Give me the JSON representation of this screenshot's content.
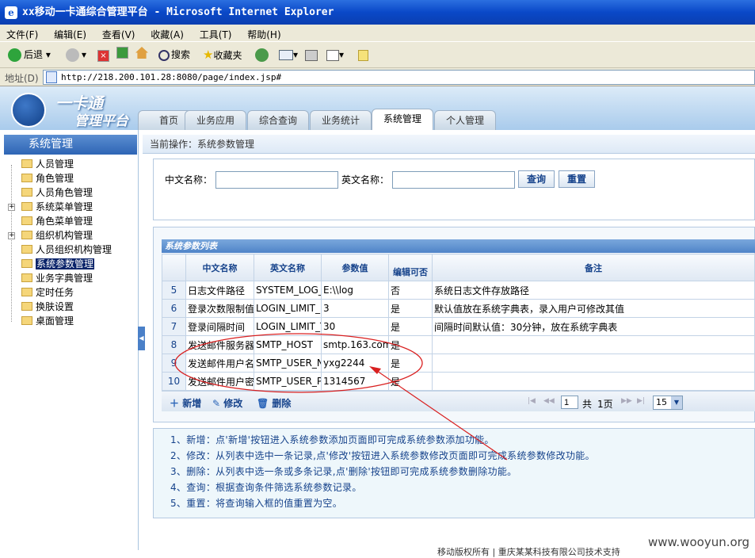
{
  "window": {
    "title": "xx移动一卡通综合管理平台 - Microsoft Internet Explorer"
  },
  "menu": [
    "文件(F)",
    "编辑(E)",
    "查看(V)",
    "收藏(A)",
    "工具(T)",
    "帮助(H)"
  ],
  "toolbar": {
    "back": "后退",
    "search": "搜索",
    "favorites": "收藏夹"
  },
  "address": {
    "label": "地址(D)",
    "url": "http://218.200.101.28:8080/page/index.jsp#"
  },
  "app": {
    "logo_line1": "一卡通",
    "logo_line2": "管理平台"
  },
  "tabs": [
    "首页",
    "业务应用",
    "综合查询",
    "业务统计",
    "系统管理",
    "个人管理"
  ],
  "sidebar": {
    "title": "系统管理",
    "items": [
      "人员管理",
      "角色管理",
      "人员角色管理",
      "系统菜单管理",
      "角色菜单管理",
      "组织机构管理",
      "人员组织机构管理",
      "系统参数管理",
      "业务字典管理",
      "定时任务",
      "换肤设置",
      "桌面管理"
    ]
  },
  "breadcrumb": "当前操作：系统参数管理",
  "search": {
    "cn_label": "中文名称：",
    "en_label": "英文名称：",
    "query": "查询",
    "reset": "重置",
    "cn_value": "",
    "en_value": ""
  },
  "grid": {
    "title": "系统参数列表",
    "columns": [
      "",
      "中文名称",
      "英文名称",
      "参数值",
      "编辑可否",
      "备注"
    ],
    "rows": [
      [
        "5",
        "日志文件路径",
        "SYSTEM_LOG_PATH",
        "E:\\\\log",
        "否",
        "系统日志文件存放路径"
      ],
      [
        "6",
        "登录次数限制值",
        "LOGIN_LIMIT_NUM",
        "3",
        "是",
        "默认值放在系统字典表，录入用户可修改其值"
      ],
      [
        "7",
        "登录间隔时间",
        "LOGIN_LIMIT_TIME",
        "30",
        "是",
        "间隔时间默认值：30分钟，放在系统字典表"
      ],
      [
        "8",
        "发送邮件服务器",
        "SMTP_HOST",
        "smtp.163.com",
        "是",
        ""
      ],
      [
        "9",
        "发送邮件用户名",
        "SMTP_USER_NAME",
        "yxg2244",
        "是",
        ""
      ],
      [
        "10",
        "发送邮件用户密码",
        "SMTP_USER_PASSWORD",
        "1314567",
        "是",
        ""
      ]
    ]
  },
  "pager": {
    "add": "新增",
    "edit": "修改",
    "delete": "删除",
    "page": "1",
    "total_prefix": "共",
    "total": "1页",
    "size": "15"
  },
  "help": [
    "1、新增：点'新增'按钮进入系统参数添加页面即可完成系统参数添加功能。",
    "2、修改：从列表中选中一条记录,点'修改'按钮进入系统参数修改页面即可完成系统参数修改功能。",
    "3、删除：从列表中选一条或多条记录,点'删除'按钮即可完成系统参数删除功能。",
    "4、查询：根据查询条件筛选系统参数记录。",
    "5、重置：将查询输入框的值重置为空。"
  ],
  "footer": "移动版权所有 | 重庆某某科技有限公司技术支持",
  "watermark": "www.wooyun.org",
  "colors": {
    "annotation": "#d92020",
    "header_bar": "#4f84c8"
  }
}
